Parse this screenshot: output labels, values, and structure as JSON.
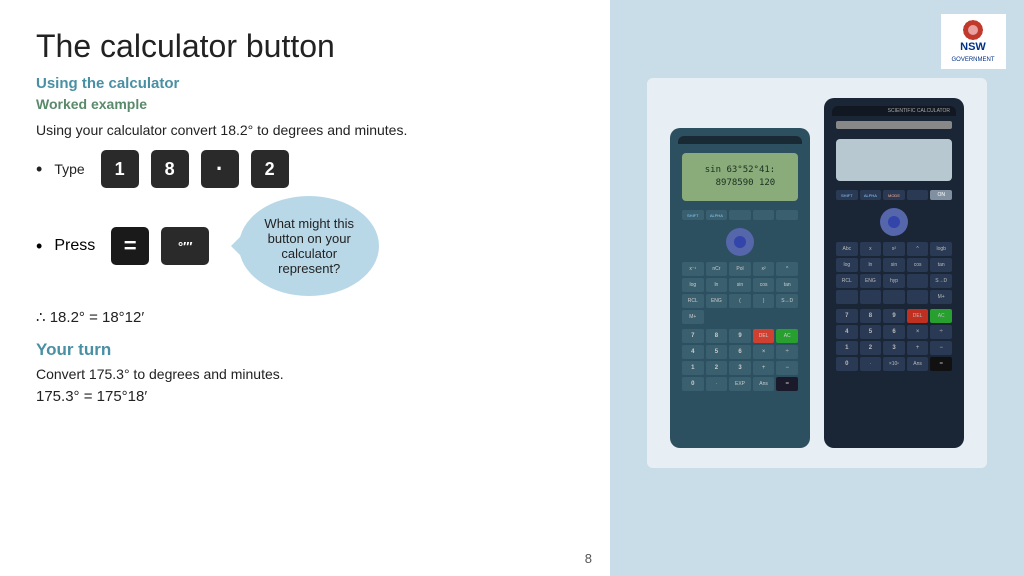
{
  "page": {
    "title": "The calculator button",
    "section_heading": "Using the calculator",
    "sub_heading": "Worked example",
    "instruction": "Using your calculator convert 18.2° to degrees and minutes.",
    "type_label": "Type",
    "press_label": "Press",
    "result": "∴ 18.2° = 18°12′",
    "your_turn_heading": "Your turn",
    "convert_instruction": "Convert 175.3° to degrees and minutes.",
    "answer": "175.3° = 175°18′",
    "bubble_text": "What might this button on your calculator represent?",
    "page_number": "8",
    "keys_type": [
      "1",
      "8",
      "•",
      "2"
    ],
    "calculator_screen_left": "sin 63°52°41:\n8978590 120",
    "calculator_screen_right": ""
  },
  "nsw_logo": {
    "text": "NSW\nGOVERNMENT",
    "flower_color": "#c0392b",
    "bg_color": "#fff"
  },
  "colors": {
    "heading_blue": "#4a90a4",
    "subheading_green": "#5a8a6a",
    "bubble_blue": "#b8d8ea",
    "key_dark": "#2a2a2a",
    "right_panel_bg": "#c8dde8"
  }
}
